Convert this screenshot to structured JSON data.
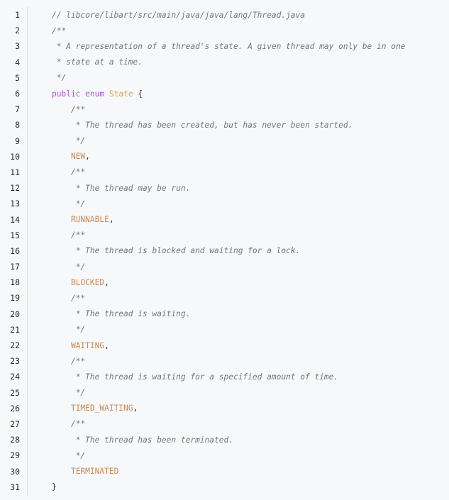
{
  "lines": [
    {
      "n": "1",
      "indent": "",
      "parts": [
        {
          "t": "// libcore/libart/src/main/java/java/lang/Thread.java",
          "c": "comment"
        }
      ]
    },
    {
      "n": "2",
      "indent": "",
      "parts": [
        {
          "t": "/**",
          "c": "comment"
        }
      ]
    },
    {
      "n": "3",
      "indent": "",
      "parts": [
        {
          "t": " * A representation of a thread's state. A given thread may only be in one",
          "c": "comment"
        }
      ]
    },
    {
      "n": "4",
      "indent": "",
      "parts": [
        {
          "t": " * state at a time.",
          "c": "comment"
        }
      ]
    },
    {
      "n": "5",
      "indent": "",
      "parts": [
        {
          "t": " */",
          "c": "comment"
        }
      ]
    },
    {
      "n": "6",
      "indent": "",
      "parts": [
        {
          "t": "public",
          "c": "keyword"
        },
        {
          "t": " ",
          "c": "punct"
        },
        {
          "t": "enum",
          "c": "keyword"
        },
        {
          "t": " ",
          "c": "punct"
        },
        {
          "t": "State",
          "c": "type"
        },
        {
          "t": " {",
          "c": "punct"
        }
      ]
    },
    {
      "n": "7",
      "indent": "    ",
      "parts": [
        {
          "t": "/**",
          "c": "comment"
        }
      ]
    },
    {
      "n": "8",
      "indent": "    ",
      "parts": [
        {
          "t": " * The thread has been created, but has never been started.",
          "c": "comment"
        }
      ]
    },
    {
      "n": "9",
      "indent": "    ",
      "parts": [
        {
          "t": " */",
          "c": "comment"
        }
      ]
    },
    {
      "n": "10",
      "indent": "    ",
      "parts": [
        {
          "t": "NEW",
          "c": "const"
        },
        {
          "t": ",",
          "c": "punct"
        }
      ]
    },
    {
      "n": "11",
      "indent": "    ",
      "parts": [
        {
          "t": "/**",
          "c": "comment"
        }
      ]
    },
    {
      "n": "12",
      "indent": "    ",
      "parts": [
        {
          "t": " * The thread may be run.",
          "c": "comment"
        }
      ]
    },
    {
      "n": "13",
      "indent": "    ",
      "parts": [
        {
          "t": " */",
          "c": "comment"
        }
      ]
    },
    {
      "n": "14",
      "indent": "    ",
      "parts": [
        {
          "t": "RUNNABLE",
          "c": "const"
        },
        {
          "t": ",",
          "c": "punct"
        }
      ]
    },
    {
      "n": "15",
      "indent": "    ",
      "parts": [
        {
          "t": "/**",
          "c": "comment"
        }
      ]
    },
    {
      "n": "16",
      "indent": "    ",
      "parts": [
        {
          "t": " * The thread is blocked and waiting for a lock.",
          "c": "comment"
        }
      ]
    },
    {
      "n": "17",
      "indent": "    ",
      "parts": [
        {
          "t": " */",
          "c": "comment"
        }
      ]
    },
    {
      "n": "18",
      "indent": "    ",
      "parts": [
        {
          "t": "BLOCKED",
          "c": "const"
        },
        {
          "t": ",",
          "c": "punct"
        }
      ]
    },
    {
      "n": "19",
      "indent": "    ",
      "parts": [
        {
          "t": "/**",
          "c": "comment"
        }
      ]
    },
    {
      "n": "20",
      "indent": "    ",
      "parts": [
        {
          "t": " * The thread is waiting.",
          "c": "comment"
        }
      ]
    },
    {
      "n": "21",
      "indent": "    ",
      "parts": [
        {
          "t": " */",
          "c": "comment"
        }
      ]
    },
    {
      "n": "22",
      "indent": "    ",
      "parts": [
        {
          "t": "WAITING",
          "c": "const"
        },
        {
          "t": ",",
          "c": "punct"
        }
      ]
    },
    {
      "n": "23",
      "indent": "    ",
      "parts": [
        {
          "t": "/**",
          "c": "comment"
        }
      ]
    },
    {
      "n": "24",
      "indent": "    ",
      "parts": [
        {
          "t": " * The thread is waiting for a specified amount of time.",
          "c": "comment"
        }
      ]
    },
    {
      "n": "25",
      "indent": "    ",
      "parts": [
        {
          "t": " */",
          "c": "comment"
        }
      ]
    },
    {
      "n": "26",
      "indent": "    ",
      "parts": [
        {
          "t": "TIMED_WAITING",
          "c": "const"
        },
        {
          "t": ",",
          "c": "punct"
        }
      ]
    },
    {
      "n": "27",
      "indent": "    ",
      "parts": [
        {
          "t": "/**",
          "c": "comment"
        }
      ]
    },
    {
      "n": "28",
      "indent": "    ",
      "parts": [
        {
          "t": " * The thread has been terminated.",
          "c": "comment"
        }
      ]
    },
    {
      "n": "29",
      "indent": "    ",
      "parts": [
        {
          "t": " */",
          "c": "comment"
        }
      ]
    },
    {
      "n": "30",
      "indent": "    ",
      "parts": [
        {
          "t": "TERMINATED",
          "c": "const"
        }
      ]
    },
    {
      "n": "31",
      "indent": "",
      "parts": [
        {
          "t": "}",
          "c": "punct"
        }
      ]
    }
  ],
  "colors": {
    "background": "#f6f8fa",
    "comment": "#6e7781",
    "keyword": "#a656c7",
    "type": "#d9a05b",
    "constant": "#c78a55",
    "text": "#24292f"
  }
}
